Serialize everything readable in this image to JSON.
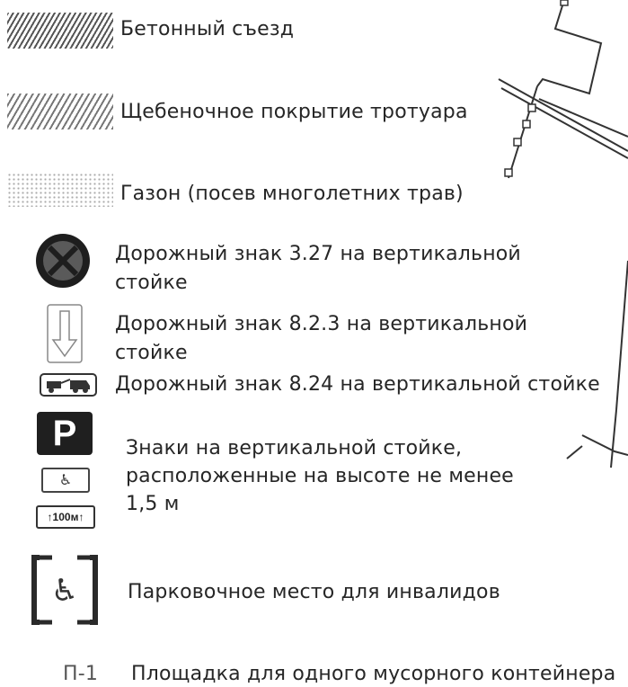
{
  "legend": {
    "concrete": "Бетонный съезд",
    "gravel": "Щебеночное покрытие тротуара",
    "lawn": "Газон (посев многолетних трав)",
    "sign_327_line1": "Дорожный знак 3.27 на вертикальной",
    "sign_327_line2": "стойке",
    "sign_823_line1": "Дорожный знак 8.2.3 на вертикальной",
    "sign_823_line2": "стойке",
    "sign_824": "Дорожный знак 8.24 на вертикальной стойке",
    "signs_group_line1": "Знаки на вертикальной стойке,",
    "signs_group_line2": "расположенные на высоте не менее",
    "signs_group_line3": "1,5 м",
    "parking_disabled": "Парковочное место для инвалидов",
    "platform_code": "П-1",
    "platform": "Площадка для одного мусорного контейнера"
  },
  "symbols": {
    "parking_letter": "P",
    "distance_plate": "↑100м↑",
    "wheelchair": "♿"
  }
}
